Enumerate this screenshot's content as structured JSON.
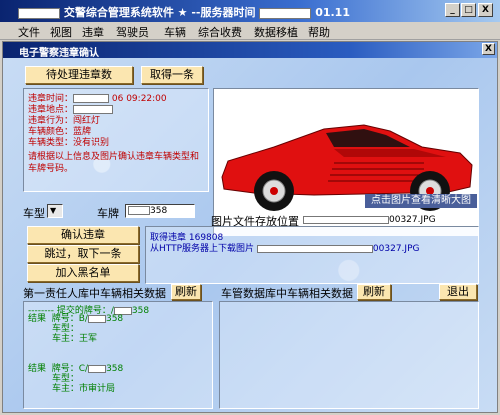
{
  "app": {
    "title_suffix": "交警综合管理系统软件 ★  --服务器时间",
    "server_time": "01.11",
    "window_buttons": [
      "_",
      "□",
      "X"
    ]
  },
  "menu": [
    "文件",
    "视图",
    "违章",
    "驾驶员",
    "车辆",
    "综合收费",
    "数据移植",
    "帮助"
  ],
  "dialog": {
    "title": "电子警察违章确认",
    "close": "X"
  },
  "buttons": {
    "pending": "待处理违章数",
    "get_one": "取得一条",
    "confirm": "确认违章",
    "skip": "跳过，取下一条",
    "blacklist": "加入黑名单",
    "refresh1": "刷新",
    "refresh2": "刷新",
    "exit": "退出"
  },
  "violation": {
    "time_label": "违章时间：",
    "time_value": "06 09:22:00",
    "place_label": "违章地点：",
    "action_label": "违章行为：",
    "action_value": "闯红灯",
    "color_label": "车辆颜色：",
    "color_value": "蓝牌",
    "type_label": "车辆类型：",
    "type_value": "没有识别",
    "note": "请根据以上信息及图片确认违章车辆类型和车牌号码。"
  },
  "image_hint": "点击图片查看清晰大图",
  "car_type_label": "车型",
  "plate_label": "车牌",
  "plate_suffix": "358",
  "file_path_label": "图片文件存放位置",
  "file_path_suffix": "00327.JPG",
  "log": {
    "line1": "取得违章  169808",
    "line2_prefix": "从HTTP服务器上下载图片",
    "line2_suffix": "00327.JPG"
  },
  "left_section": {
    "title": "第一责任人库中车辆相关数据",
    "header": "-------- 提交的牌号：/",
    "header_suffix": "358",
    "results": [
      {
        "tag": "结果",
        "plate_label": "牌号：B/",
        "plate_suffix": "358",
        "type_label": "车型：",
        "owner_label": "车主：",
        "owner": "王军"
      },
      {
        "tag": "结果",
        "plate_label": "牌号：C/",
        "plate_suffix": "358",
        "type_label": "车型：",
        "owner_label": "车主：",
        "owner": "市审计局"
      }
    ]
  },
  "right_section": {
    "title": "车管数据库中车辆相关数据"
  },
  "colors": {
    "accent": "#0a2470",
    "button": "#fbe6b0",
    "violation_text": "#c00000",
    "log_text": "#0000a8",
    "car": "#e01010"
  }
}
